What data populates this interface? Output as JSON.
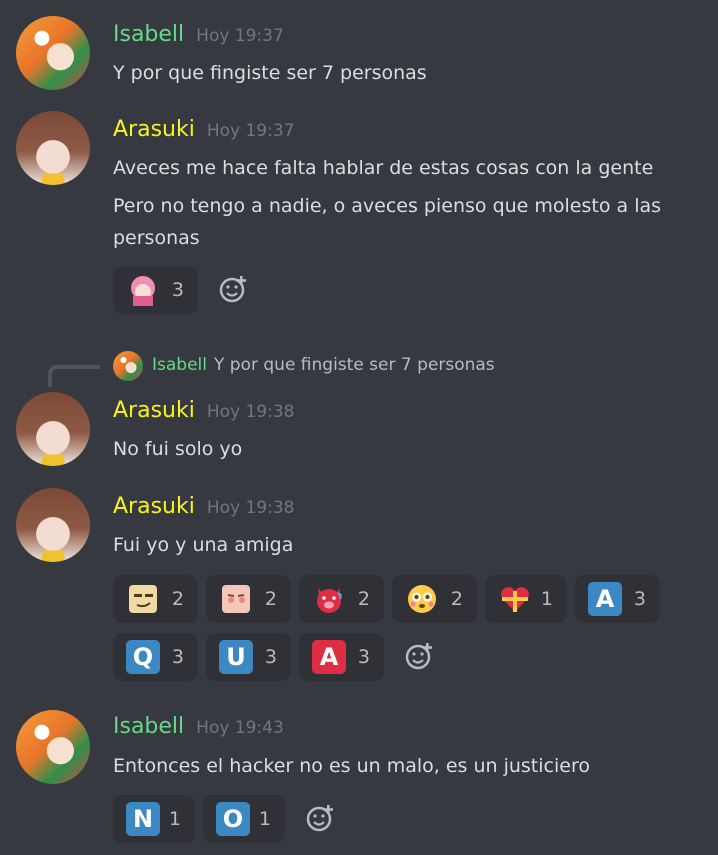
{
  "messages": [
    {
      "author": "Isabell",
      "time": "Hoy 19:37",
      "lines": [
        "Y por que fingiste ser 7 personas"
      ]
    },
    {
      "author": "Arasuki",
      "time": "Hoy 19:37",
      "lines": [
        "Aveces me hace falta hablar de estas cosas con la gente",
        "Pero no tengo a nadie, o aveces pienso que molesto a las",
        "personas"
      ],
      "reactions": [
        {
          "emoji": "pink-hair-anime-emoji",
          "count": "3"
        }
      ]
    },
    {
      "reply": {
        "author": "Isabell",
        "text": "Y por que fingiste ser 7 personas"
      },
      "author": "Arasuki",
      "time": "Hoy 19:38",
      "lines": [
        "No fui solo yo"
      ]
    },
    {
      "author": "Arasuki",
      "time": "Hoy 19:38",
      "lines": [
        "Fui yo y una amiga"
      ],
      "reactions": [
        {
          "emoji": "smug-face-emoji",
          "count": "2"
        },
        {
          "emoji": "blushing-anime-emoji",
          "count": "2"
        },
        {
          "emoji": "red-devil-pig-emoji",
          "count": "2"
        },
        {
          "emoji": "flushed-face-emoji",
          "count": "2"
        },
        {
          "emoji": "gift-heart-emoji",
          "count": "1"
        },
        {
          "emoji": "regional-a-emoji",
          "letter": "A",
          "count": "3"
        },
        {
          "emoji": "regional-q-emoji",
          "letter": "Q",
          "count": "3"
        },
        {
          "emoji": "regional-u-emoji",
          "letter": "U",
          "count": "3"
        },
        {
          "emoji": "letter-a-red-emoji",
          "letter": "A",
          "count": "3"
        }
      ]
    },
    {
      "author": "Isabell",
      "time": "Hoy 19:43",
      "lines": [
        "Entonces el hacker no es un malo, es un justiciero"
      ],
      "reactions": [
        {
          "emoji": "regional-n-emoji",
          "letter": "N",
          "count": "1"
        },
        {
          "emoji": "regional-o-emoji",
          "letter": "O",
          "count": "1"
        }
      ]
    }
  ],
  "colors": {
    "isabell": "#69d889",
    "arasuki": "#f7f41d",
    "background": "#36393f",
    "reaction_bg": "#2f3136"
  }
}
